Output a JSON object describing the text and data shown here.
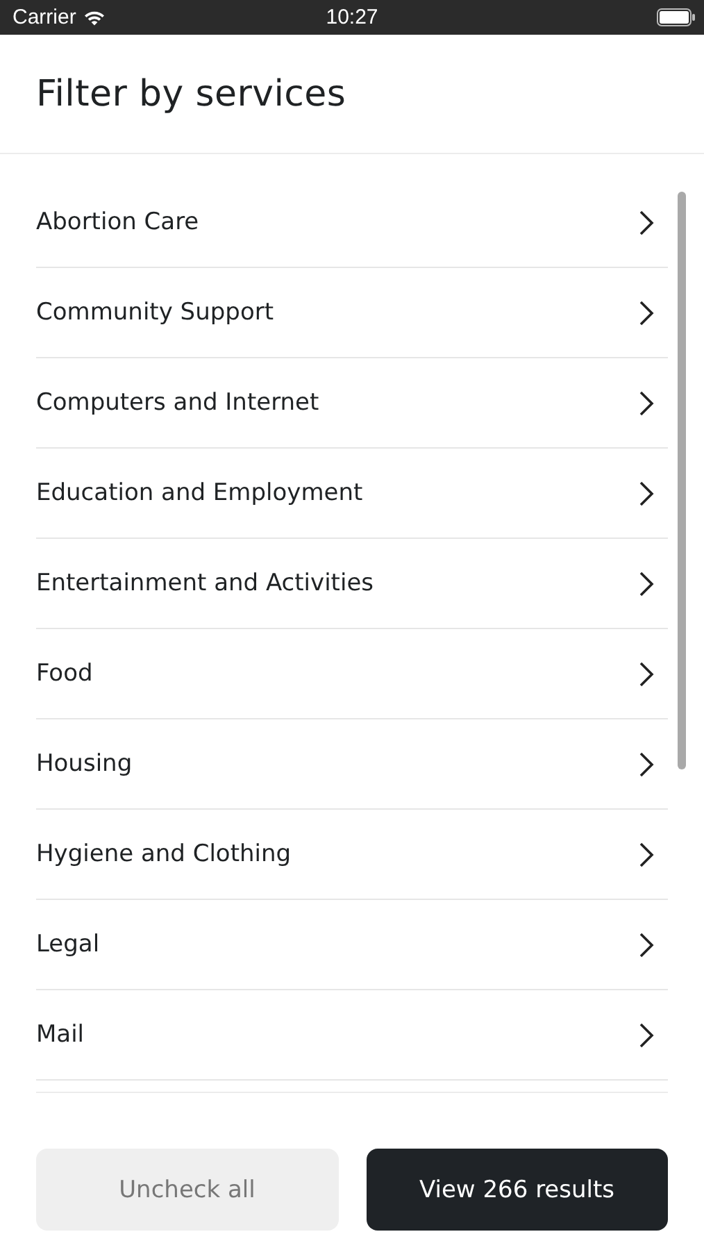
{
  "status_bar": {
    "carrier": "Carrier",
    "time": "10:27"
  },
  "title": "Filter by services",
  "services": [
    {
      "label": "Abortion Care"
    },
    {
      "label": "Community Support"
    },
    {
      "label": "Computers and Internet"
    },
    {
      "label": "Education and Employment"
    },
    {
      "label": "Entertainment and Activities"
    },
    {
      "label": "Food"
    },
    {
      "label": "Housing"
    },
    {
      "label": "Hygiene and Clothing"
    },
    {
      "label": "Legal"
    },
    {
      "label": "Mail"
    }
  ],
  "buttons": [
    {
      "label": "Uncheck all",
      "kind": "secondary",
      "disabled": true
    },
    {
      "label": "View 266 results",
      "kind": "primary",
      "disabled": false
    }
  ]
}
